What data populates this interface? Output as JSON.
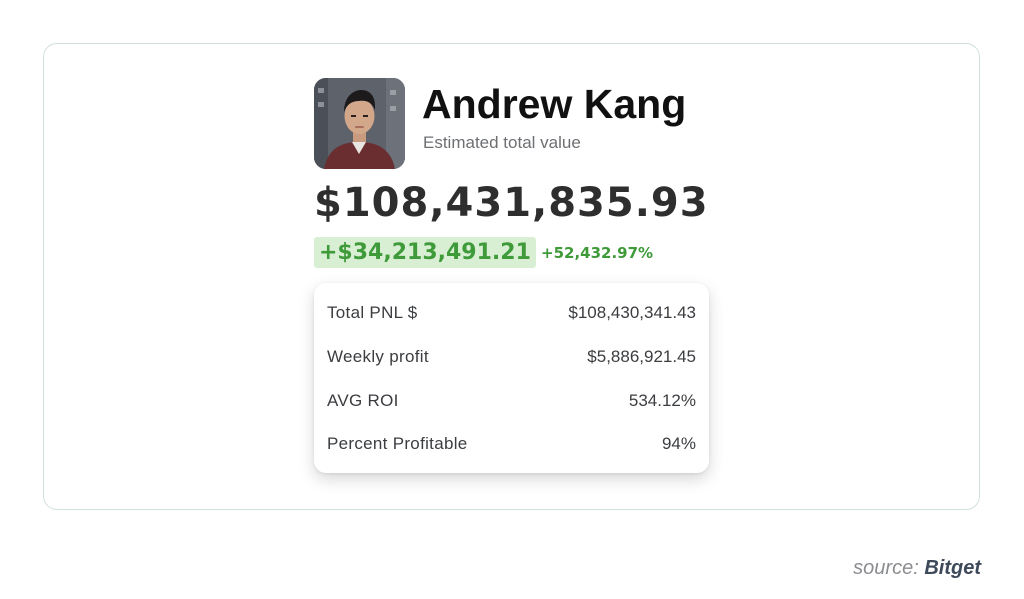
{
  "profile": {
    "name": "Andrew Kang",
    "subtitle": "Estimated total value"
  },
  "portfolio": {
    "total_value": "$108,431,835.93",
    "change_amount": "+$34,213,491.21",
    "change_percent": "+52,432.97%"
  },
  "stats": [
    {
      "label": "Total PNL $",
      "value": "$108,430,341.43"
    },
    {
      "label": "Weekly profit",
      "value": "$5,886,921.45"
    },
    {
      "label": "AVG ROI",
      "value": "534.12%"
    },
    {
      "label": "Percent Profitable",
      "value": "94%"
    }
  ],
  "source": {
    "prefix": "source:",
    "brand": "Bitget"
  },
  "colors": {
    "positive": "#3f9a3a",
    "positive_bg": "#d9efd4",
    "frame_border": "#cfe0de"
  },
  "icons": {
    "avatar": "profile-photo"
  }
}
